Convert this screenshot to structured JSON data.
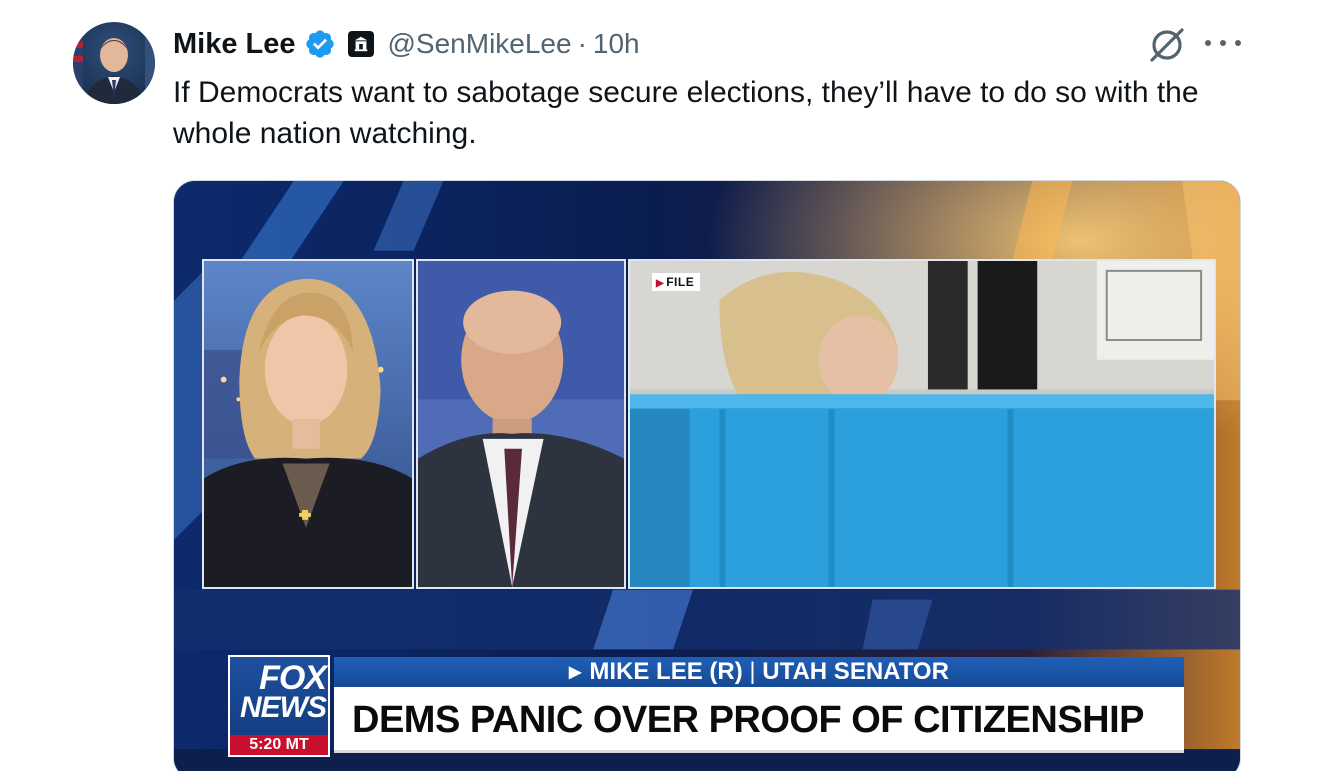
{
  "tweet": {
    "author": {
      "display_name": "Mike Lee",
      "handle": "@SenMikeLee",
      "verified_icon": "verified-badge-icon",
      "affiliation_icon": "government-building-icon"
    },
    "separator": "·",
    "timestamp": "10h",
    "text": "If Democrats want to sabotage secure elections, they’ll have to do so with the whole nation watching.",
    "actions": {
      "grok_icon": "grok-icon",
      "more_icon": "more-options-icon"
    }
  },
  "media": {
    "file_tag": "FILE",
    "network_logo": {
      "line1": "FOX",
      "line2": "NEWS",
      "time": "5:20 MT"
    },
    "lower_third": {
      "arrow": "▶",
      "name": "MIKE LEE (R)",
      "divider": " | ",
      "title": "UTAH SENATOR",
      "headline": "DEMS PANIC OVER PROOF OF CITIZENSHIP"
    }
  },
  "colors": {
    "verified_blue": "#1d9bf0",
    "fox_blue": "#1e4f9e",
    "fox_red": "#c8102e",
    "text_secondary": "#536471"
  }
}
